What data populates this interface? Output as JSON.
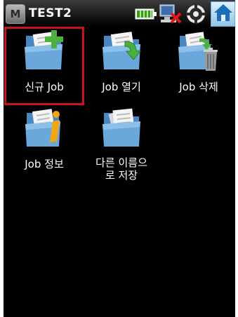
{
  "window": {
    "title": "TEST2",
    "menu_icon": "M"
  },
  "status_icons": [
    "battery-icon",
    "computer-disconnected-icon",
    "gps-icon",
    "home-icon"
  ],
  "colors": {
    "selection_border": "#c8141a",
    "background": "#000000",
    "folder": "#6aa8dc",
    "plus": "#4bb13d"
  },
  "tiles": [
    {
      "label": "신규 Job",
      "icon": "new-job-icon"
    },
    {
      "label": "Job 열기",
      "icon": "open-job-icon"
    },
    {
      "label": "Job 삭제",
      "icon": "delete-job-icon"
    },
    {
      "label": "Job 정보",
      "icon": "job-info-icon"
    },
    {
      "label": "다른 이름으\n로 저장",
      "icon": "save-as-icon"
    }
  ]
}
